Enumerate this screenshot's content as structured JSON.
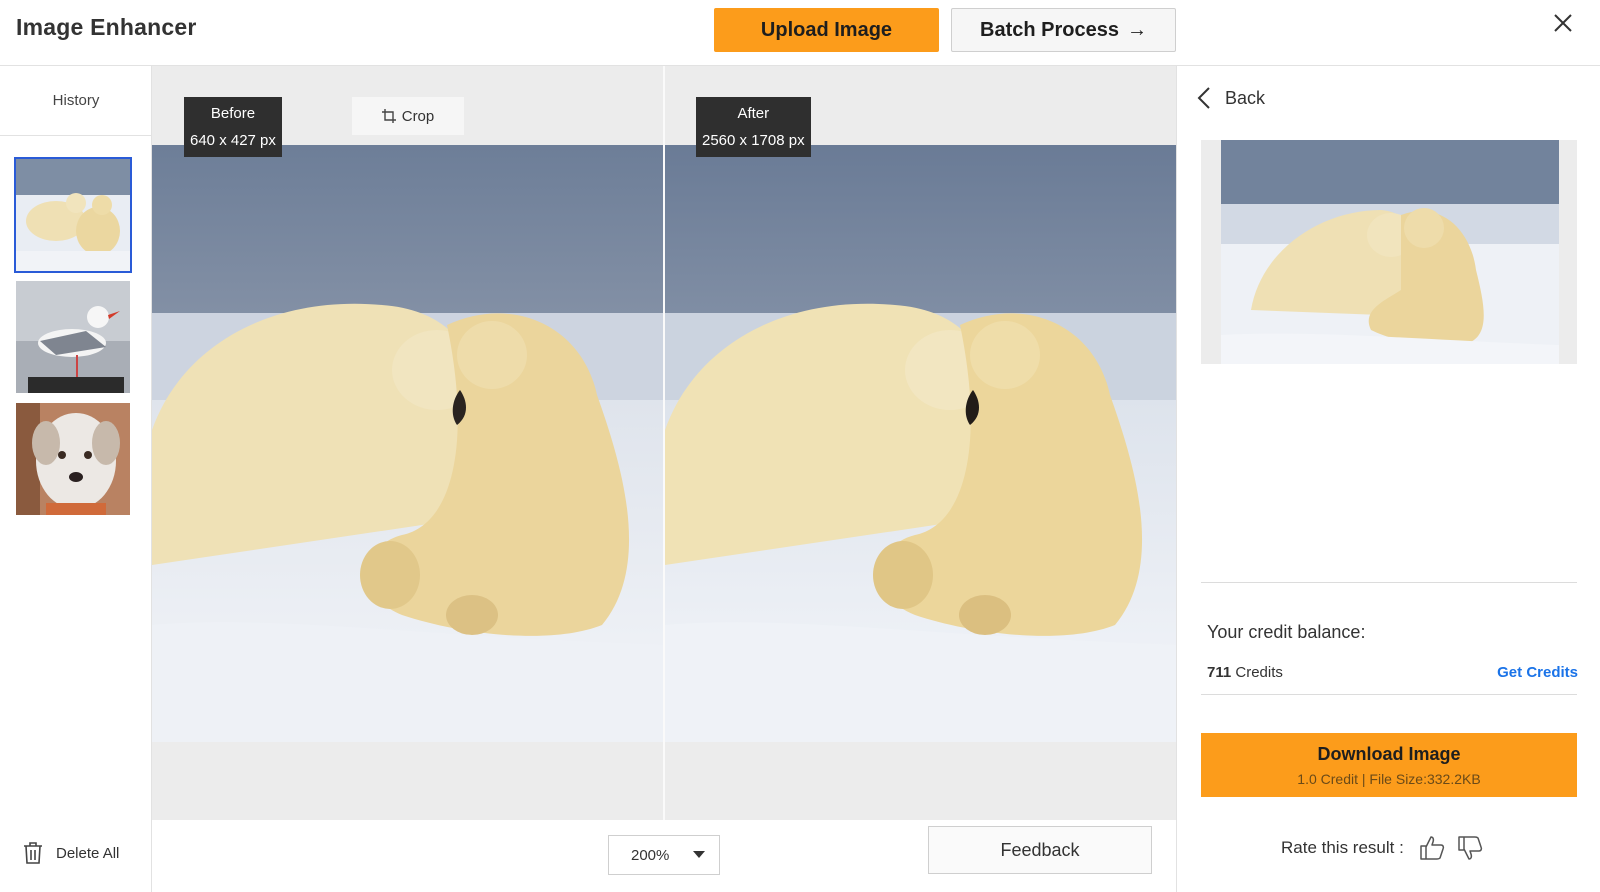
{
  "header": {
    "title": "Image Enhancer",
    "upload_label": "Upload Image",
    "batch_label": "Batch Process",
    "batch_arrow": "→"
  },
  "sidebar": {
    "history_label": "History",
    "thumbnails": [
      {
        "subject": "polar-bears",
        "selected": true
      },
      {
        "subject": "seagull",
        "selected": false
      },
      {
        "subject": "dog",
        "selected": false
      }
    ],
    "delete_all_label": "Delete All"
  },
  "compare": {
    "before": {
      "label": "Before",
      "dims": "640 x 427 px"
    },
    "after": {
      "label": "After",
      "dims": "2560 x 1708 px"
    },
    "crop_label": "Crop"
  },
  "toolbar": {
    "zoom_value": "200%",
    "feedback_label": "Feedback"
  },
  "right_panel": {
    "back_label": "Back",
    "credit_title": "Your credit balance:",
    "credit_amount": "711",
    "credit_unit": "Credits",
    "get_credits_label": "Get Credits",
    "download_label": "Download Image",
    "download_sub": "1.0 Credit | File Size:332.2KB",
    "rate_label": "Rate this result :"
  },
  "colors": {
    "accent_orange": "#fc9c1b",
    "link_blue": "#1a73e8",
    "selected_outline": "#2a5bd7"
  }
}
